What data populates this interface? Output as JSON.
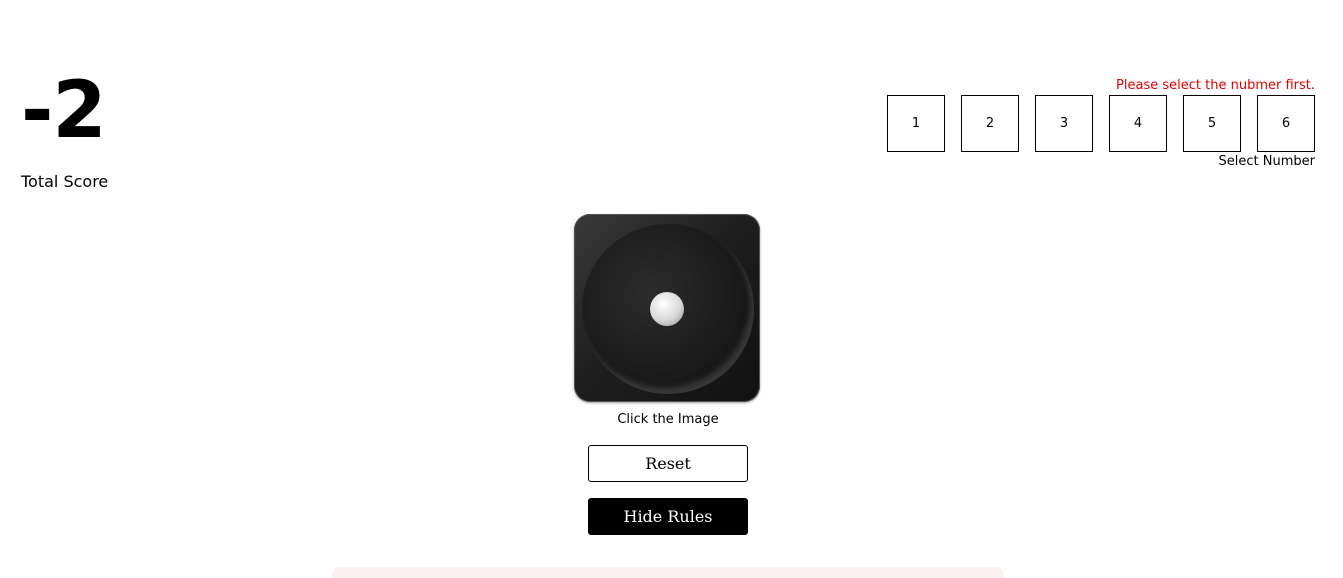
{
  "score": {
    "value": "-2",
    "label": "Total Score"
  },
  "selector": {
    "error": "Please select the nubmer first.",
    "numbers": [
      "1",
      "2",
      "3",
      "4",
      "5",
      "6"
    ],
    "label": "Select Number"
  },
  "dice": {
    "icon": "dice-one-icon",
    "caption": "Click the Image"
  },
  "buttons": {
    "reset": "Reset",
    "rules": "Hide Rules"
  },
  "colors": {
    "error": "#e00000",
    "primary": "#000000",
    "panel": "#fbf0f0"
  }
}
